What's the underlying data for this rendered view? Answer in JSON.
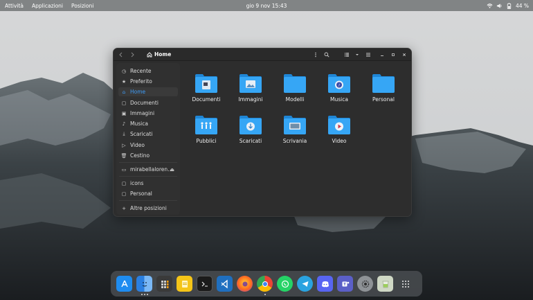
{
  "topbar": {
    "activities": "Attività",
    "applications": "Applicazioni",
    "places": "Posizioni",
    "clock": "gio 9 nov  15:43",
    "battery": "44 %"
  },
  "window": {
    "title": "Home"
  },
  "sidebar": {
    "items": [
      {
        "label": "Recente",
        "icon": "clock-icon"
      },
      {
        "label": "Preferito",
        "icon": "star-icon"
      },
      {
        "label": "Home",
        "icon": "home-icon",
        "active": true
      },
      {
        "label": "Documenti",
        "icon": "document-icon"
      },
      {
        "label": "Immagini",
        "icon": "image-icon"
      },
      {
        "label": "Musica",
        "icon": "music-icon"
      },
      {
        "label": "Scaricati",
        "icon": "download-icon"
      },
      {
        "label": "Video",
        "icon": "video-icon"
      },
      {
        "label": "Cestino",
        "icon": "trash-icon"
      }
    ],
    "device": "mirabellaloren…",
    "bookmarks": [
      "icons",
      "Personal"
    ],
    "other": "Altre posizioni"
  },
  "files": [
    {
      "label": "Documenti",
      "emblem": "document"
    },
    {
      "label": "Immagini",
      "emblem": "image"
    },
    {
      "label": "Modelli",
      "emblem": "none"
    },
    {
      "label": "Musica",
      "emblem": "music"
    },
    {
      "label": "Personal",
      "emblem": "none"
    },
    {
      "label": "Pubblici",
      "emblem": "people"
    },
    {
      "label": "Scaricati",
      "emblem": "download"
    },
    {
      "label": "Scrivania",
      "emblem": "desktop"
    },
    {
      "label": "Video",
      "emblem": "video"
    }
  ],
  "dock": {
    "apps": [
      "app-store",
      "finder",
      "calculator",
      "notes",
      "terminal",
      "vscode",
      "firefox",
      "chrome",
      "whatsapp",
      "telegram",
      "discord",
      "teams",
      "settings",
      "trash",
      "app-grid"
    ]
  },
  "colors": {
    "accent": "#3d9bf5",
    "folder": "#2f9cf0",
    "window_bg": "#2d2d2d"
  }
}
